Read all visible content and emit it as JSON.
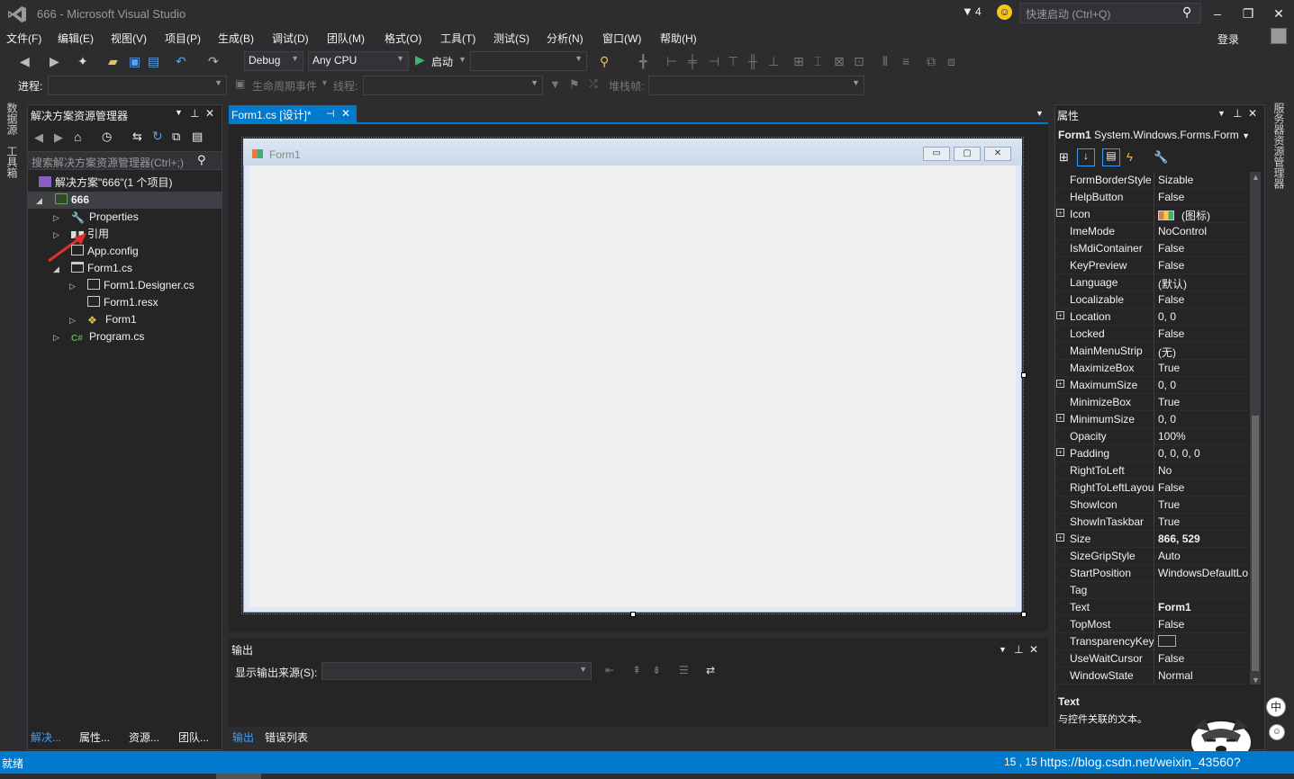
{
  "titlebar": {
    "title": "666 - Microsoft Visual Studio",
    "notifications_count": "4",
    "quick_launch_placeholder": "快速启动 (Ctrl+Q)"
  },
  "menubar": {
    "items": [
      "文件(F)",
      "编辑(E)",
      "视图(V)",
      "项目(P)",
      "生成(B)",
      "调试(D)",
      "团队(M)",
      "格式(O)",
      "工具(T)",
      "测试(S)",
      "分析(N)",
      "窗口(W)",
      "帮助(H)"
    ],
    "login": "登录"
  },
  "toolbar": {
    "config": "Debug",
    "platform": "Any CPU",
    "start_label": "启动",
    "process_label": "进程:",
    "lifecycle_label": "生命周期事件",
    "thread_label": "线程:",
    "stack_label": "堆栈帧:"
  },
  "left_vtabs": [
    "数据源",
    "工具箱"
  ],
  "solution_explorer": {
    "title": "解决方案资源管理器",
    "search_placeholder": "搜索解决方案资源管理器(Ctrl+;)",
    "tree": [
      {
        "label": "解决方案\"666\"(1 个项目)",
        "icon": "solution-icon"
      },
      {
        "label": "666",
        "icon": "csharp-project-icon"
      },
      {
        "label": "Properties",
        "icon": "wrench-icon"
      },
      {
        "label": "引用",
        "icon": "references-icon"
      },
      {
        "label": "App.config",
        "icon": "config-file-icon"
      },
      {
        "label": "Form1.cs",
        "icon": "form-icon"
      },
      {
        "label": "Form1.Designer.cs",
        "icon": "designer-file-icon"
      },
      {
        "label": "Form1.resx",
        "icon": "resx-file-icon"
      },
      {
        "label": "Form1",
        "icon": "class-icon"
      },
      {
        "label": "Program.cs",
        "icon": "csharp-file-icon"
      }
    ],
    "bottom_tabs": [
      "解决...",
      "属性...",
      "资源...",
      "团队..."
    ]
  },
  "document": {
    "tab_label": "Form1.cs [设计]*",
    "form_title": "Form1"
  },
  "output": {
    "title": "输出",
    "source_label": "显示输出来源(S):",
    "tabs": [
      "输出",
      "错误列表"
    ]
  },
  "properties": {
    "title": "属性",
    "object_name": "Form1",
    "object_type": "System.Windows.Forms.Form",
    "rows": [
      {
        "name": "FormBorderStyle",
        "value": "Sizable",
        "expand": false,
        "bold": false
      },
      {
        "name": "HelpButton",
        "value": "False",
        "expand": false,
        "bold": false
      },
      {
        "name": "Icon",
        "value": "(图标)",
        "expand": true,
        "bold": false
      },
      {
        "name": "ImeMode",
        "value": "NoControl",
        "expand": false,
        "bold": false
      },
      {
        "name": "IsMdiContainer",
        "value": "False",
        "expand": false,
        "bold": false
      },
      {
        "name": "KeyPreview",
        "value": "False",
        "expand": false,
        "bold": false
      },
      {
        "name": "Language",
        "value": "(默认)",
        "expand": false,
        "bold": false
      },
      {
        "name": "Localizable",
        "value": "False",
        "expand": false,
        "bold": false
      },
      {
        "name": "Location",
        "value": "0, 0",
        "expand": true,
        "bold": false
      },
      {
        "name": "Locked",
        "value": "False",
        "expand": false,
        "bold": false
      },
      {
        "name": "MainMenuStrip",
        "value": "(无)",
        "expand": false,
        "bold": false
      },
      {
        "name": "MaximizeBox",
        "value": "True",
        "expand": false,
        "bold": false
      },
      {
        "name": "MaximumSize",
        "value": "0, 0",
        "expand": true,
        "bold": false
      },
      {
        "name": "MinimizeBox",
        "value": "True",
        "expand": false,
        "bold": false
      },
      {
        "name": "MinimumSize",
        "value": "0, 0",
        "expand": true,
        "bold": false
      },
      {
        "name": "Opacity",
        "value": "100%",
        "expand": false,
        "bold": false
      },
      {
        "name": "Padding",
        "value": "0, 0, 0, 0",
        "expand": true,
        "bold": false
      },
      {
        "name": "RightToLeft",
        "value": "No",
        "expand": false,
        "bold": false
      },
      {
        "name": "RightToLeftLayout",
        "value": "False",
        "expand": false,
        "bold": false
      },
      {
        "name": "ShowIcon",
        "value": "True",
        "expand": false,
        "bold": false
      },
      {
        "name": "ShowInTaskbar",
        "value": "True",
        "expand": false,
        "bold": false
      },
      {
        "name": "Size",
        "value": "866, 529",
        "expand": true,
        "bold": true
      },
      {
        "name": "SizeGripStyle",
        "value": "Auto",
        "expand": false,
        "bold": false
      },
      {
        "name": "StartPosition",
        "value": "WindowsDefaultLocation",
        "expand": false,
        "bold": false
      },
      {
        "name": "Tag",
        "value": "",
        "expand": false,
        "bold": false
      },
      {
        "name": "Text",
        "value": "Form1",
        "expand": false,
        "bold": true
      },
      {
        "name": "TopMost",
        "value": "False",
        "expand": false,
        "bold": false
      },
      {
        "name": "TransparencyKey",
        "value": "",
        "expand": false,
        "bold": false
      },
      {
        "name": "UseWaitCursor",
        "value": "False",
        "expand": false,
        "bold": false
      },
      {
        "name": "WindowState",
        "value": "Normal",
        "expand": false,
        "bold": false
      }
    ],
    "desc_name": "Text",
    "desc_text": "与控件关联的文本。"
  },
  "right_vtabs": [
    "服务器资源管理器"
  ],
  "statusbar": {
    "status": "就绪",
    "position": "15 , 15",
    "watermark": "https://blog.csdn.net/weixin_43560?"
  },
  "colors": {
    "accent": "#007acc",
    "background": "#2d2d30",
    "panel": "#252526"
  }
}
